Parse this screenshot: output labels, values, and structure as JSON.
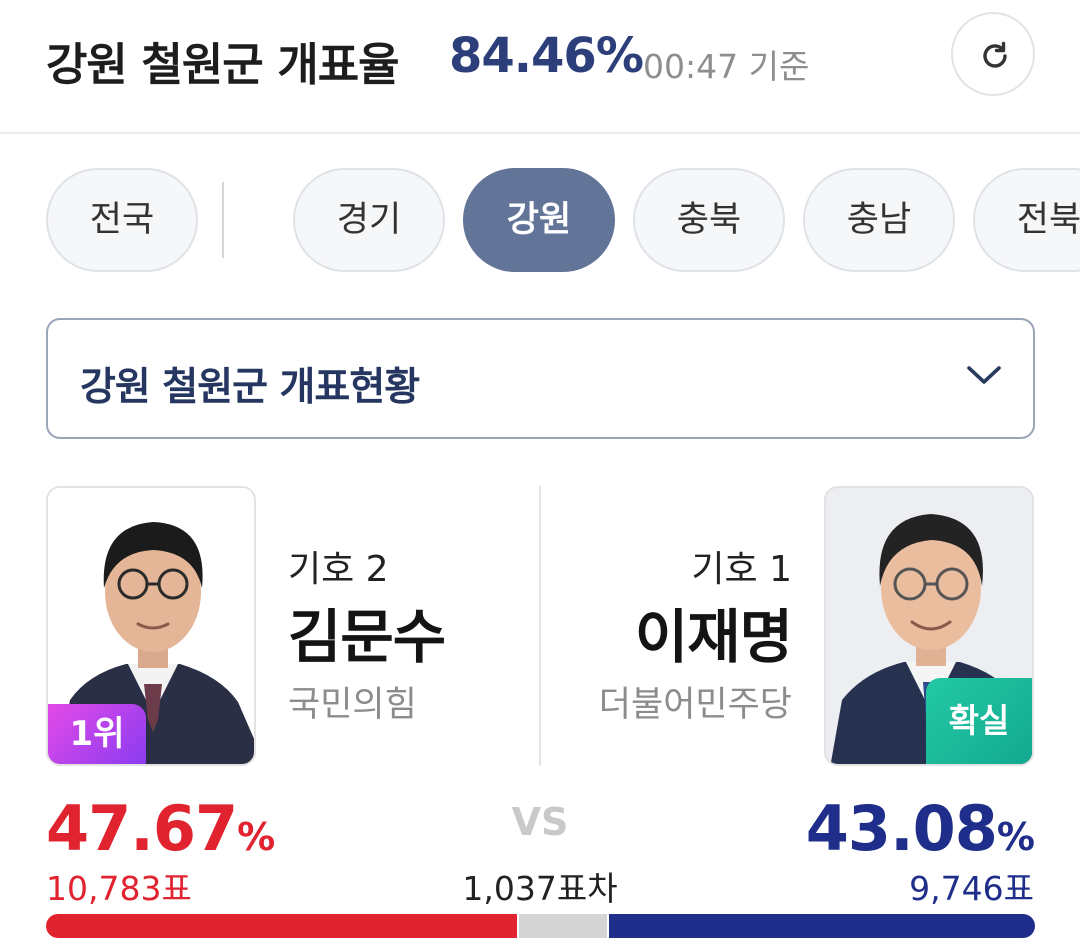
{
  "header": {
    "title": "강원 철원군 개표율",
    "rate": "84.46%",
    "time": "00:47 기준"
  },
  "tabs": [
    {
      "label": "전국",
      "active": false
    },
    {
      "label": "경기",
      "active": false
    },
    {
      "label": "강원",
      "active": true
    },
    {
      "label": "충북",
      "active": false
    },
    {
      "label": "충남",
      "active": false
    },
    {
      "label": "전북",
      "active": false
    }
  ],
  "dropdown": {
    "label": "강원 철원군 개표현황"
  },
  "candidates": {
    "left": {
      "number_label": "기호 2",
      "name": "김문수",
      "party": "국민의힘",
      "rank_badge": "1위",
      "percent": "47.67",
      "percent_unit": "%",
      "votes": "10,783표",
      "color": "#e0232f"
    },
    "right": {
      "number_label": "기호 1",
      "name": "이재명",
      "party": "더불어민주당",
      "status_badge": "확실",
      "percent": "43.08",
      "percent_unit": "%",
      "votes": "9,746표",
      "color": "#1f2e8a"
    }
  },
  "versus": {
    "label": "VS",
    "difference": "1,037표차"
  },
  "vote_bar": {
    "left_share": 47.67,
    "right_share": 43.08
  },
  "colors": {
    "active_tab": "#637499",
    "rate": "#2d3f7a",
    "rank_badge": "#b544ec",
    "confirm_badge": "#19b999"
  },
  "icons": [
    "refresh-icon",
    "chevron-down-icon"
  ]
}
